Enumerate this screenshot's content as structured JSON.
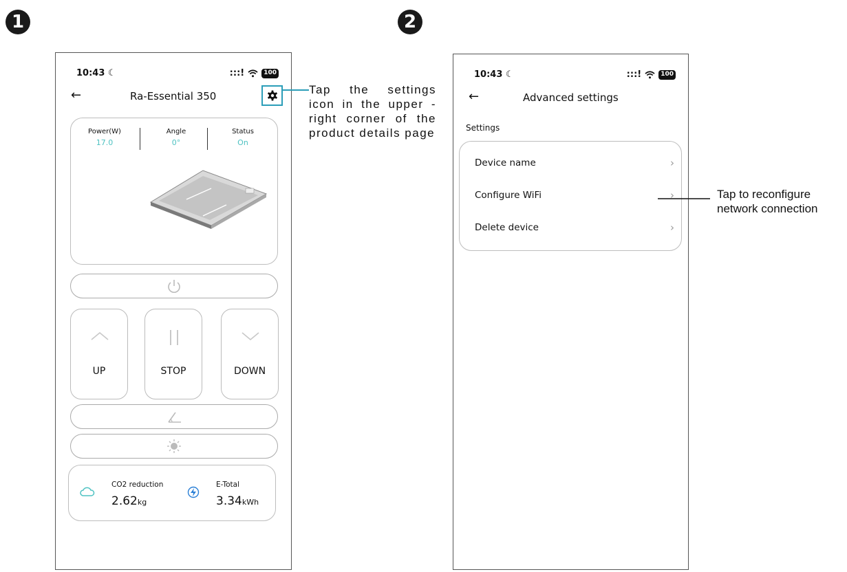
{
  "steps": [
    "1",
    "2"
  ],
  "screen1": {
    "status": {
      "time": "10:43",
      "signal": ":::!",
      "battery": "100"
    },
    "title": "Ra-Essential 350",
    "stats": [
      {
        "label": "Power(W)",
        "value": "17.0"
      },
      {
        "label": "Angle",
        "value": "0°"
      },
      {
        "label": "Status",
        "value": "On"
      }
    ],
    "controls": {
      "up": "UP",
      "stop": "STOP",
      "down": "DOWN"
    },
    "energy": {
      "co2_label": "CO2 reduction",
      "co2_value": "2.62",
      "co2_unit": "kg",
      "etotal_label": "E-Total",
      "etotal_value": "3.34",
      "etotal_unit": "kWh"
    },
    "accent_color": "#4ec2c2"
  },
  "screen2": {
    "status": {
      "time": "10:43",
      "signal": ":::!",
      "battery": "100"
    },
    "title": "Advanced settings",
    "section": "Settings",
    "items": [
      "Device name",
      "Configure WiFi",
      "Delete device"
    ]
  },
  "annotations": {
    "settings_tip": "Tap the settings icon in the upper -right corner of the product details page",
    "wifi_tip": "Tap to reconfigure network connection"
  },
  "icons": [
    "back-arrow-icon",
    "gear-icon",
    "power-icon",
    "chevron-up-icon",
    "pause-icon",
    "chevron-down-icon",
    "angle-icon",
    "sun-icon",
    "co2-cloud-icon",
    "energy-bolt-icon",
    "chevron-right-icon"
  ]
}
